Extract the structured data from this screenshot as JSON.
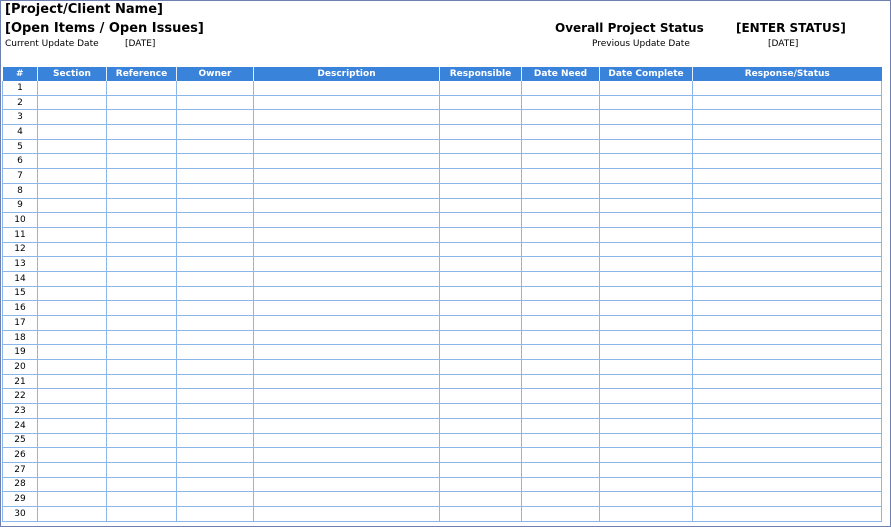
{
  "header": {
    "project_name": "[Project/Client Name]",
    "subtitle": "[Open Items / Open Issues]",
    "current_update_label": "Current Update Date",
    "current_update_value": "[DATE]",
    "overall_status_label": "Overall Project Status",
    "overall_status_value": "[ENTER STATUS]",
    "previous_update_label": "Previous Update Date",
    "previous_update_value": "[DATE]"
  },
  "table": {
    "columns": [
      "#",
      "Section",
      "Reference",
      "Owner",
      "Description",
      "Responsible",
      "Date Need",
      "Date Complete",
      "Response/Status"
    ],
    "row_numbers": [
      "1",
      "2",
      "3",
      "4",
      "5",
      "6",
      "7",
      "8",
      "9",
      "10",
      "11",
      "12",
      "13",
      "14",
      "15",
      "16",
      "17",
      "18",
      "19",
      "20",
      "21",
      "22",
      "23",
      "24",
      "25",
      "26",
      "27",
      "28",
      "29",
      "30"
    ]
  },
  "colors": {
    "header_bg": "#3a83db",
    "grid_line": "#8bb6ea"
  }
}
